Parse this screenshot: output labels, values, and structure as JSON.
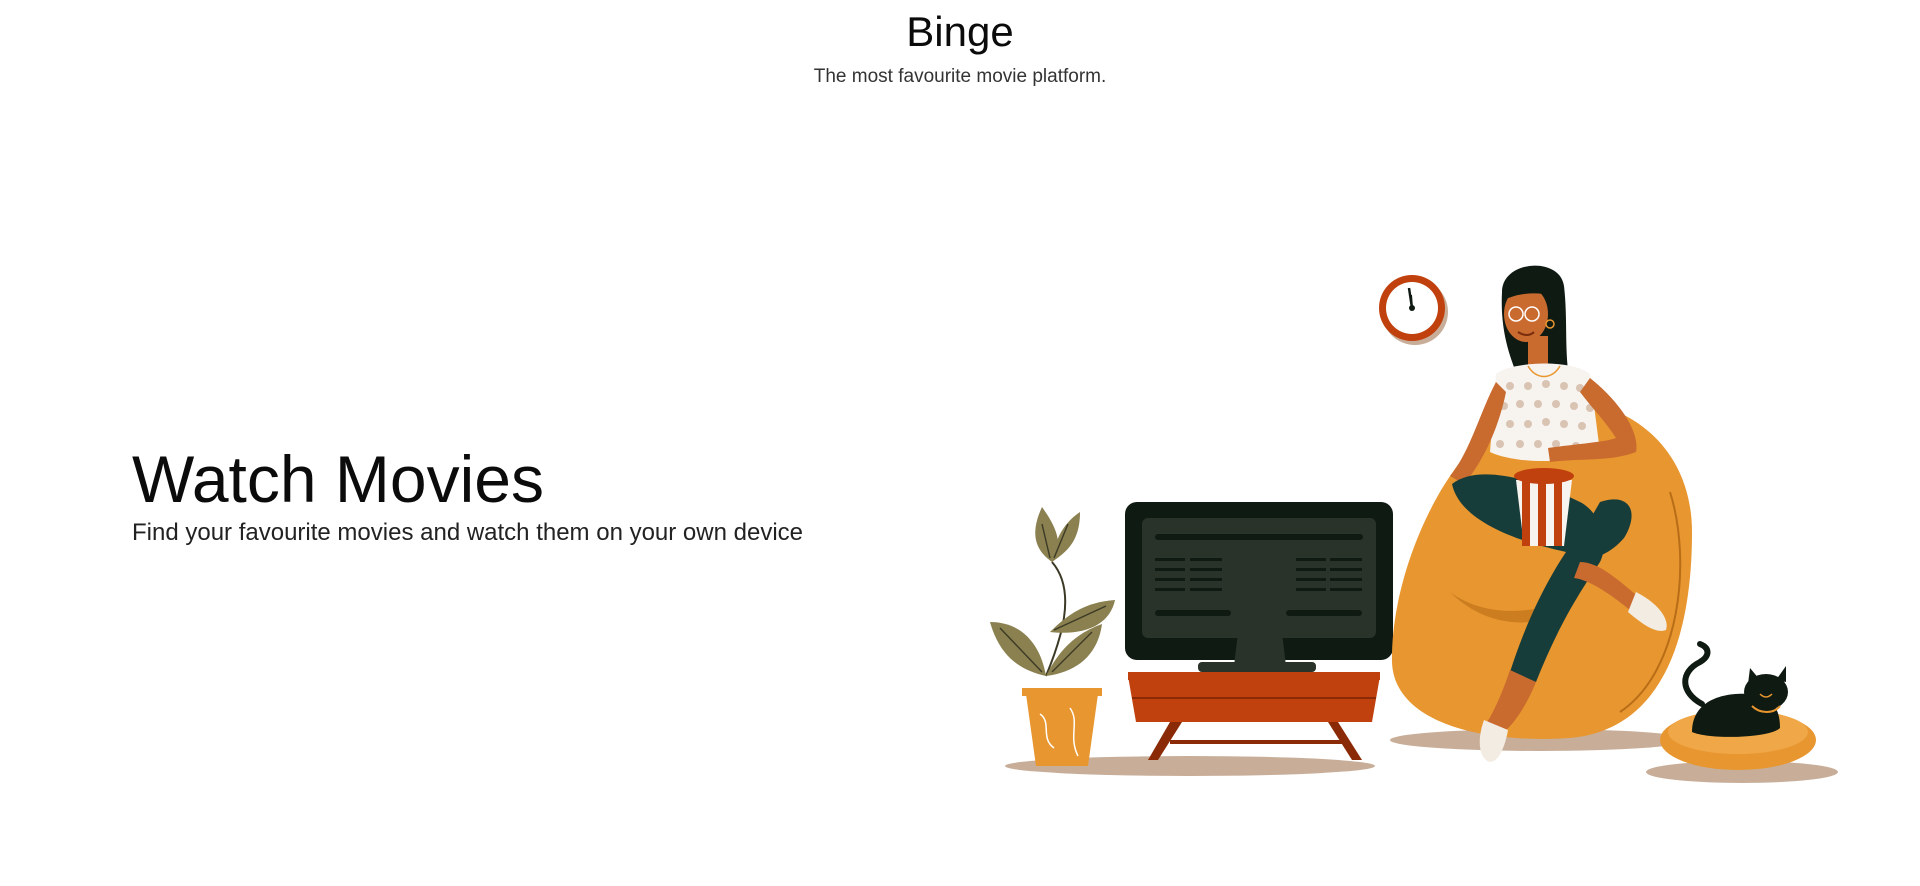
{
  "header": {
    "title": "Binge",
    "tagline": "The most favourite movie platform."
  },
  "hero": {
    "heading": "Watch Movies",
    "subheading": "Find your favourite movies and watch them on your own device"
  },
  "illustration": {
    "subject": "woman-on-beanbag-watching-tv",
    "colors": {
      "orange": "#E8962F",
      "dark_green": "#0F1A12",
      "rust": "#C0400E",
      "olive": "#8A8050",
      "shadow": "#C8AE99"
    }
  }
}
